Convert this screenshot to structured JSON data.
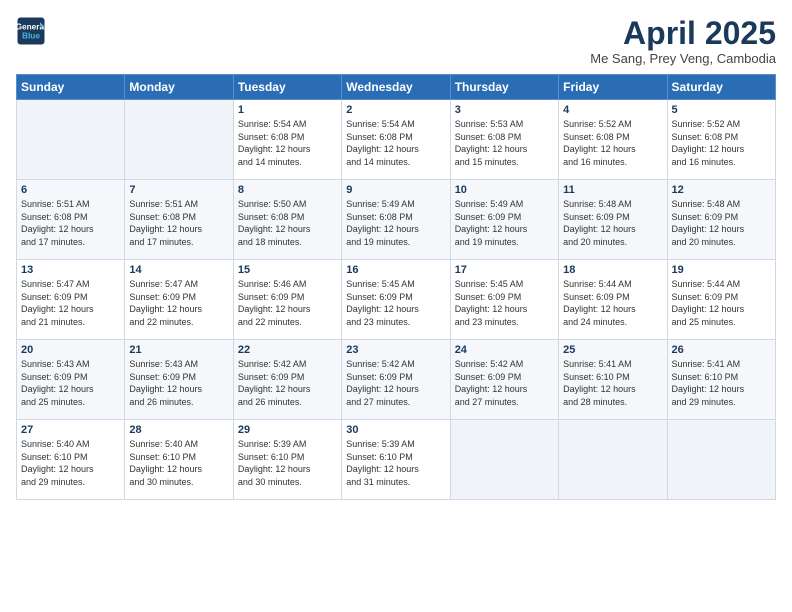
{
  "logo": {
    "line1": "General",
    "line2": "Blue"
  },
  "title": "April 2025",
  "subtitle": "Me Sang, Prey Veng, Cambodia",
  "header_days": [
    "Sunday",
    "Monday",
    "Tuesday",
    "Wednesday",
    "Thursday",
    "Friday",
    "Saturday"
  ],
  "weeks": [
    [
      {
        "num": "",
        "detail": ""
      },
      {
        "num": "",
        "detail": ""
      },
      {
        "num": "1",
        "detail": "Sunrise: 5:54 AM\nSunset: 6:08 PM\nDaylight: 12 hours\nand 14 minutes."
      },
      {
        "num": "2",
        "detail": "Sunrise: 5:54 AM\nSunset: 6:08 PM\nDaylight: 12 hours\nand 14 minutes."
      },
      {
        "num": "3",
        "detail": "Sunrise: 5:53 AM\nSunset: 6:08 PM\nDaylight: 12 hours\nand 15 minutes."
      },
      {
        "num": "4",
        "detail": "Sunrise: 5:52 AM\nSunset: 6:08 PM\nDaylight: 12 hours\nand 16 minutes."
      },
      {
        "num": "5",
        "detail": "Sunrise: 5:52 AM\nSunset: 6:08 PM\nDaylight: 12 hours\nand 16 minutes."
      }
    ],
    [
      {
        "num": "6",
        "detail": "Sunrise: 5:51 AM\nSunset: 6:08 PM\nDaylight: 12 hours\nand 17 minutes."
      },
      {
        "num": "7",
        "detail": "Sunrise: 5:51 AM\nSunset: 6:08 PM\nDaylight: 12 hours\nand 17 minutes."
      },
      {
        "num": "8",
        "detail": "Sunrise: 5:50 AM\nSunset: 6:08 PM\nDaylight: 12 hours\nand 18 minutes."
      },
      {
        "num": "9",
        "detail": "Sunrise: 5:49 AM\nSunset: 6:08 PM\nDaylight: 12 hours\nand 19 minutes."
      },
      {
        "num": "10",
        "detail": "Sunrise: 5:49 AM\nSunset: 6:09 PM\nDaylight: 12 hours\nand 19 minutes."
      },
      {
        "num": "11",
        "detail": "Sunrise: 5:48 AM\nSunset: 6:09 PM\nDaylight: 12 hours\nand 20 minutes."
      },
      {
        "num": "12",
        "detail": "Sunrise: 5:48 AM\nSunset: 6:09 PM\nDaylight: 12 hours\nand 20 minutes."
      }
    ],
    [
      {
        "num": "13",
        "detail": "Sunrise: 5:47 AM\nSunset: 6:09 PM\nDaylight: 12 hours\nand 21 minutes."
      },
      {
        "num": "14",
        "detail": "Sunrise: 5:47 AM\nSunset: 6:09 PM\nDaylight: 12 hours\nand 22 minutes."
      },
      {
        "num": "15",
        "detail": "Sunrise: 5:46 AM\nSunset: 6:09 PM\nDaylight: 12 hours\nand 22 minutes."
      },
      {
        "num": "16",
        "detail": "Sunrise: 5:45 AM\nSunset: 6:09 PM\nDaylight: 12 hours\nand 23 minutes."
      },
      {
        "num": "17",
        "detail": "Sunrise: 5:45 AM\nSunset: 6:09 PM\nDaylight: 12 hours\nand 23 minutes."
      },
      {
        "num": "18",
        "detail": "Sunrise: 5:44 AM\nSunset: 6:09 PM\nDaylight: 12 hours\nand 24 minutes."
      },
      {
        "num": "19",
        "detail": "Sunrise: 5:44 AM\nSunset: 6:09 PM\nDaylight: 12 hours\nand 25 minutes."
      }
    ],
    [
      {
        "num": "20",
        "detail": "Sunrise: 5:43 AM\nSunset: 6:09 PM\nDaylight: 12 hours\nand 25 minutes."
      },
      {
        "num": "21",
        "detail": "Sunrise: 5:43 AM\nSunset: 6:09 PM\nDaylight: 12 hours\nand 26 minutes."
      },
      {
        "num": "22",
        "detail": "Sunrise: 5:42 AM\nSunset: 6:09 PM\nDaylight: 12 hours\nand 26 minutes."
      },
      {
        "num": "23",
        "detail": "Sunrise: 5:42 AM\nSunset: 6:09 PM\nDaylight: 12 hours\nand 27 minutes."
      },
      {
        "num": "24",
        "detail": "Sunrise: 5:42 AM\nSunset: 6:09 PM\nDaylight: 12 hours\nand 27 minutes."
      },
      {
        "num": "25",
        "detail": "Sunrise: 5:41 AM\nSunset: 6:10 PM\nDaylight: 12 hours\nand 28 minutes."
      },
      {
        "num": "26",
        "detail": "Sunrise: 5:41 AM\nSunset: 6:10 PM\nDaylight: 12 hours\nand 29 minutes."
      }
    ],
    [
      {
        "num": "27",
        "detail": "Sunrise: 5:40 AM\nSunset: 6:10 PM\nDaylight: 12 hours\nand 29 minutes."
      },
      {
        "num": "28",
        "detail": "Sunrise: 5:40 AM\nSunset: 6:10 PM\nDaylight: 12 hours\nand 30 minutes."
      },
      {
        "num": "29",
        "detail": "Sunrise: 5:39 AM\nSunset: 6:10 PM\nDaylight: 12 hours\nand 30 minutes."
      },
      {
        "num": "30",
        "detail": "Sunrise: 5:39 AM\nSunset: 6:10 PM\nDaylight: 12 hours\nand 31 minutes."
      },
      {
        "num": "",
        "detail": ""
      },
      {
        "num": "",
        "detail": ""
      },
      {
        "num": "",
        "detail": ""
      }
    ]
  ]
}
